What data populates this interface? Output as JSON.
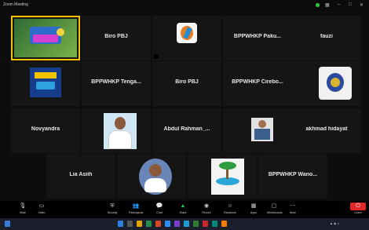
{
  "app": {
    "title": "Zoom Meeting"
  },
  "participants": [
    {
      "name": "",
      "tag": ""
    },
    {
      "name": "Biro PBJ",
      "tag": ""
    },
    {
      "name": "",
      "tag": ""
    },
    {
      "name": "BPPWHKP Paku...",
      "tag": ""
    },
    {
      "name": "fauzi",
      "tag": ""
    },
    {
      "name": "",
      "tag": ""
    },
    {
      "name": "BPPWHKP Tenga...",
      "tag": ""
    },
    {
      "name": "Biro PBJ",
      "tag": ""
    },
    {
      "name": "BPPWHKP Cirebo...",
      "tag": ""
    },
    {
      "name": "",
      "tag": ""
    },
    {
      "name": "Novyandra",
      "tag": ""
    },
    {
      "name": "",
      "tag": ""
    },
    {
      "name": "Abdul Rahman_...",
      "tag": ""
    },
    {
      "name": "",
      "tag": ""
    },
    {
      "name": "akhmad hidayat",
      "tag": ""
    },
    {
      "name": "Lia Asiih",
      "tag": ""
    },
    {
      "name": "",
      "tag": ""
    },
    {
      "name": "",
      "tag": ""
    },
    {
      "name": "BPPWHKP Wano...",
      "tag": ""
    }
  ],
  "controls": [
    {
      "label": "Mute",
      "icon": "microphone-icon"
    },
    {
      "label": "Video",
      "icon": "video-camera-icon"
    },
    {
      "label": "Security",
      "icon": "shield-icon"
    },
    {
      "label": "Participants",
      "icon": "people-icon"
    },
    {
      "label": "Chat",
      "icon": "chat-icon"
    },
    {
      "label": "Share",
      "icon": "share-screen-icon"
    },
    {
      "label": "Record",
      "icon": "record-icon"
    },
    {
      "label": "Reactions",
      "icon": "smiley-icon"
    },
    {
      "label": "Apps",
      "icon": "apps-icon"
    },
    {
      "label": "Whiteboards",
      "icon": "whiteboard-icon"
    },
    {
      "label": "More",
      "icon": "more-icon"
    },
    {
      "label": "Leave",
      "icon": "leave-icon"
    }
  ],
  "colors": {
    "leave": "#e02828",
    "active_speaker": "#f2c200",
    "accent": "#2d8cff"
  }
}
